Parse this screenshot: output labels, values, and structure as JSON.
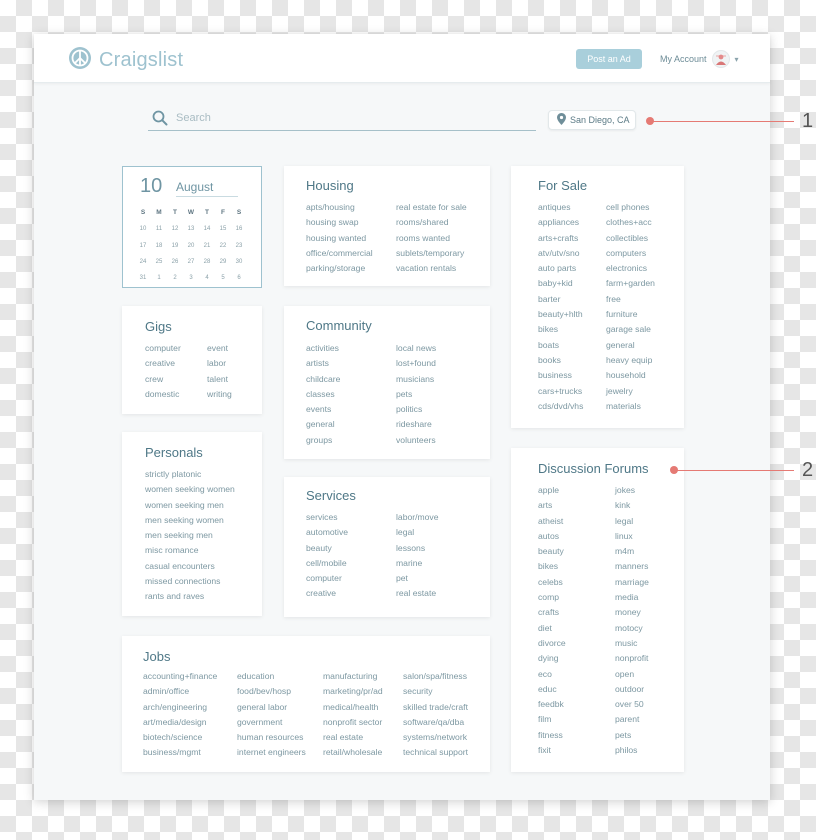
{
  "header": {
    "logo_text": "Craigslist",
    "post_button": "Post an Ad",
    "account_label": "My Account",
    "account_icon": "avatar-icon",
    "dropdown_icon": "chevron-down-icon"
  },
  "search": {
    "placeholder": "Search",
    "icon": "search-icon"
  },
  "location": {
    "label": "San Diego, CA",
    "icon": "map-pin-icon"
  },
  "calendar": {
    "day": "10",
    "month": "August",
    "weekday_headers": [
      "S",
      "M",
      "T",
      "W",
      "T",
      "F",
      "S"
    ],
    "dates": [
      "10",
      "11",
      "12",
      "13",
      "14",
      "15",
      "16",
      "17",
      "18",
      "19",
      "20",
      "21",
      "22",
      "23",
      "24",
      "25",
      "26",
      "27",
      "28",
      "29",
      "30",
      "31",
      "1",
      "2",
      "3",
      "4",
      "5",
      "6"
    ]
  },
  "sections": {
    "housing": {
      "title": "Housing",
      "items": [
        "apts/housing",
        "real estate for sale",
        "housing swap",
        "rooms/shared",
        "housing wanted",
        "rooms wanted",
        "office/commercial",
        "sublets/temporary",
        "parking/storage",
        "vacation rentals"
      ]
    },
    "gigs": {
      "title": "Gigs",
      "items": [
        "computer",
        "event",
        "creative",
        "labor",
        "crew",
        "talent",
        "domestic",
        "writing"
      ]
    },
    "community": {
      "title": "Community",
      "items": [
        "activities",
        "local news",
        "artists",
        "lost+found",
        "childcare",
        "musicians",
        "classes",
        "pets",
        "events",
        "politics",
        "general",
        "rideshare",
        "groups",
        "volunteers"
      ]
    },
    "personals": {
      "title": "Personals",
      "items": [
        "strictly platonic",
        "women seeking women",
        "women seeking men",
        "men seeking women",
        "men seeking men",
        "misc romance",
        "casual encounters",
        "missed connections",
        "rants and raves"
      ]
    },
    "services": {
      "title": "Services",
      "items": [
        "services",
        "labor/move",
        "automotive",
        "legal",
        "beauty",
        "lessons",
        "cell/mobile",
        "marine",
        "computer",
        "pet",
        "creative",
        "real estate"
      ]
    },
    "for_sale": {
      "title": "For Sale",
      "items": [
        "antiques",
        "cell phones",
        "appliances",
        "clothes+acc",
        "arts+crafts",
        "collectibles",
        "atv/utv/sno",
        "computers",
        "auto parts",
        "electronics",
        "baby+kid",
        "farm+garden",
        "barter",
        "free",
        "beauty+hlth",
        "furniture",
        "bikes",
        "garage sale",
        "boats",
        "general",
        "books",
        "heavy equip",
        "business",
        "household",
        "cars+trucks",
        "jewelry",
        "cds/dvd/vhs",
        "materials"
      ]
    },
    "discussion_forums": {
      "title": "Discussion Forums",
      "items": [
        "apple",
        "jokes",
        "arts",
        "kink",
        "atheist",
        "legal",
        "autos",
        "linux",
        "beauty",
        "m4m",
        "bikes",
        "manners",
        "celebs",
        "marriage",
        "comp",
        "media",
        "crafts",
        "money",
        "diet",
        "motocy",
        "divorce",
        "music",
        "dying",
        "nonprofit",
        "eco",
        "open",
        "educ",
        "outdoor",
        "feedbk",
        "over 50",
        "film",
        "parent",
        "fitness",
        "pets",
        "fixit",
        "philos"
      ]
    },
    "jobs": {
      "title": "Jobs",
      "items": [
        "accounting+finance",
        "education",
        "manufacturing",
        "salon/spa/fitness",
        "admin/office",
        "food/bev/hosp",
        "marketing/pr/ad",
        "security",
        "arch/engineering",
        "general labor",
        "medical/health",
        "skilled trade/craft",
        "art/media/design",
        "government",
        "nonprofit sector",
        "software/qa/dba",
        "biotech/science",
        "human resources",
        "real estate",
        "systems/network",
        "business/mgmt",
        "internet engineers",
        "retail/wholesale",
        "technical support"
      ]
    }
  },
  "annotations": {
    "first": "1",
    "second": "2"
  },
  "colors": {
    "accent": "#9ec2cf",
    "button": "#a9cfdb",
    "annotation": "#e57a74",
    "link": "#7d98a2",
    "heading": "#4f7887"
  }
}
